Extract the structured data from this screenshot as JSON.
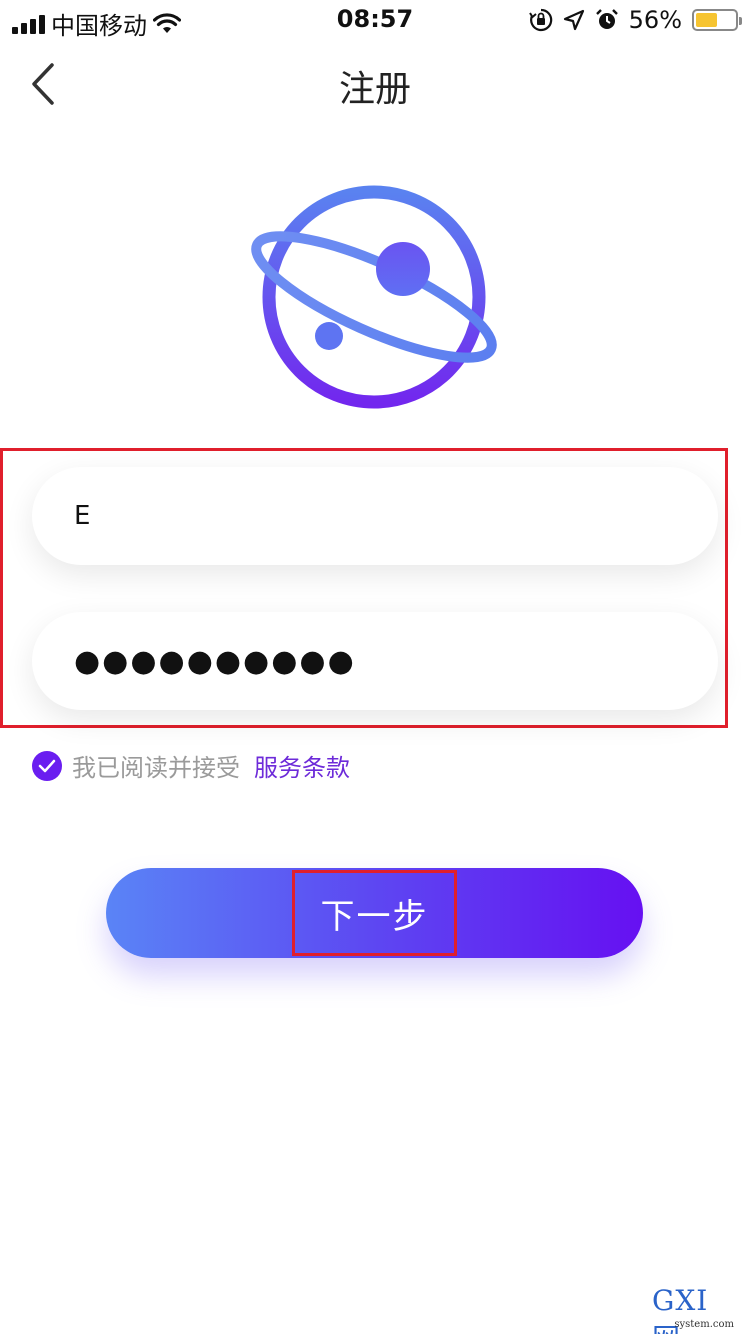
{
  "status_bar": {
    "carrier": "中国移动",
    "time": "08:57",
    "battery_percent": "56%",
    "battery_level": 0.56,
    "icons": [
      "signal-icon",
      "wifi-icon",
      "orientation-lock-icon",
      "location-icon",
      "alarm-icon",
      "battery-icon"
    ]
  },
  "nav": {
    "title": "注册",
    "back_icon": "chevron-left-icon"
  },
  "form": {
    "account_value": "E",
    "password_value": "●●●●●●●●●●"
  },
  "agreement": {
    "checked": true,
    "text": "我已阅读并接受",
    "link_text": "服务条款"
  },
  "next_button": {
    "label": "下一步"
  },
  "watermark": {
    "text": "GXI网",
    "sub": "system.com"
  },
  "colors": {
    "accent": "#6a1ef0",
    "link": "#6d2bd9",
    "gradient_start": "#5a84f6",
    "gradient_end": "#6610f2",
    "highlight": "#e01f2c"
  }
}
